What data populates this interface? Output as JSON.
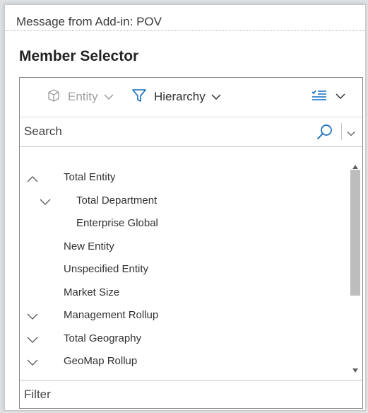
{
  "dialog": {
    "title": "Message from Add-in: POV"
  },
  "heading": "Member Selector",
  "toolbar": {
    "entity_label": "Entity",
    "entity_icon": "cube-icon",
    "hierarchy_label": "Hierarchy",
    "hierarchy_icon": "filter-icon",
    "view_icon": "checklist-icon"
  },
  "search": {
    "placeholder": "Search",
    "value": ""
  },
  "tree": {
    "items": [
      {
        "label": "Total Entity",
        "expander": "collapse",
        "level": 0
      },
      {
        "label": "Total Department",
        "expander": "expand",
        "level": 1
      },
      {
        "label": "Enterprise Global",
        "expander": "none",
        "level": 1
      },
      {
        "label": "New Entity",
        "expander": "none",
        "level": 0
      },
      {
        "label": "Unspecified Entity",
        "expander": "none",
        "level": 0
      },
      {
        "label": "Market Size",
        "expander": "none",
        "level": 0
      },
      {
        "label": "Management Rollup",
        "expander": "expand",
        "level": 0
      },
      {
        "label": "Total Geography",
        "expander": "expand",
        "level": 0
      },
      {
        "label": "GeoMap Rollup",
        "expander": "expand",
        "level": 0
      }
    ]
  },
  "filter": {
    "placeholder": "Filter",
    "value": ""
  },
  "colors": {
    "accent": "#0f6cbd",
    "text": "#323130",
    "disabled": "#a19f9d",
    "border": "#8a8886"
  }
}
